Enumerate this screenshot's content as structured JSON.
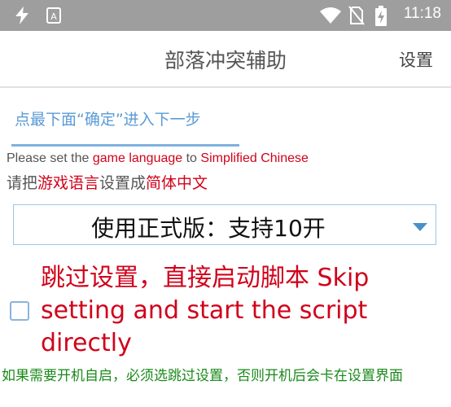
{
  "status_bar": {
    "icons": [
      "bolt-icon",
      "app-notification-icon",
      "wifi-icon",
      "no-sim-icon",
      "battery-charging-icon"
    ],
    "time": "11:18"
  },
  "toolbar": {
    "title": "部落冲突辅助",
    "settings_label": "设置"
  },
  "tab": {
    "label": "点最下面“确定”进入下一步"
  },
  "instructions": {
    "en_prefix": "Please set the ",
    "en_highlight1": "game language",
    "en_middle": " to ",
    "en_highlight2": "Simplified Chinese",
    "cn_prefix": "请把",
    "cn_highlight1": "游戏语言",
    "cn_middle": "设置成",
    "cn_highlight2": "简体中文"
  },
  "version_select": {
    "selected": "使用正式版：支持10开"
  },
  "skip_option": {
    "checked": false,
    "label": "跳过设置，直接启动脚本 Skip setting and start the script directly"
  },
  "note": "如果需要开机自启，必须选跳过设置，否则开机后会卡在设置界面",
  "colors": {
    "status_bar": "#9e9e9e",
    "accent_blue": "#5b9bd5",
    "highlight_red": "#d0021b",
    "note_green": "#1a8a1a"
  }
}
